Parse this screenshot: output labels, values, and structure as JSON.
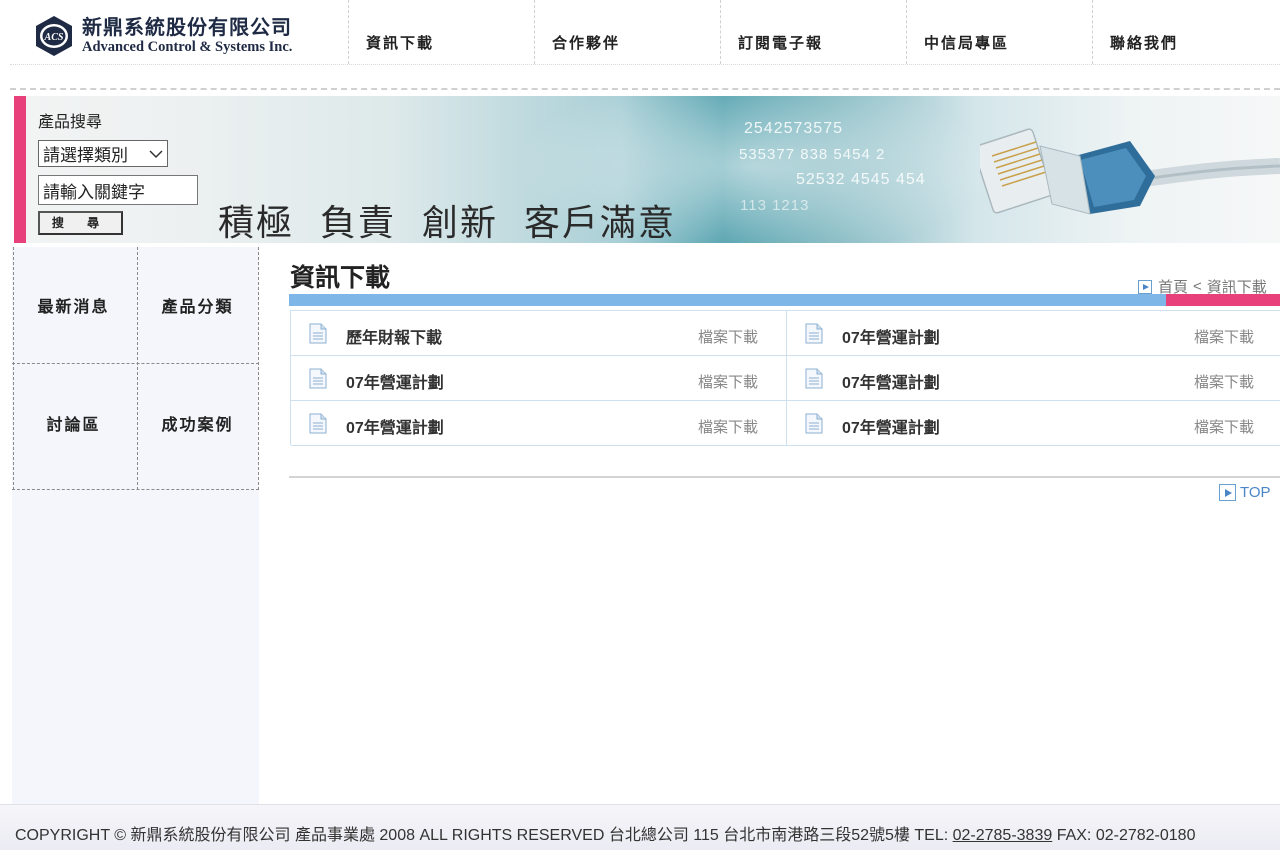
{
  "header": {
    "logo": {
      "mark": "ACS",
      "name_cn": "新鼎系統股份有限公司",
      "name_en": "Advanced Control & Systems Inc."
    },
    "nav": [
      {
        "label": "資訊下載"
      },
      {
        "label": "合作夥伴"
      },
      {
        "label": "訂閱電子報"
      },
      {
        "label": "中信局專區"
      },
      {
        "label": "聯絡我們"
      }
    ]
  },
  "banner": {
    "numbers": [
      "2542573575",
      "535377 838 5454 2",
      "52532 4545 454",
      "113 1213"
    ],
    "slogan": "積極 負責 創新 客戶滿意",
    "search": {
      "title": "產品搜尋",
      "select_value": "請選擇類別",
      "input_value": "請輸入關鍵字",
      "button_label": "搜 尋"
    }
  },
  "sidebar": {
    "items": [
      {
        "label": "最新消息"
      },
      {
        "label": "產品分類"
      },
      {
        "label": "討論區"
      },
      {
        "label": "成功案例"
      }
    ]
  },
  "main": {
    "title": "資訊下載",
    "breadcrumb": {
      "home": "首頁",
      "separator": "<",
      "current": "資訊下載"
    },
    "files": [
      {
        "name": "歷年財報下載",
        "action": "檔案下載"
      },
      {
        "name": "07年營運計劃",
        "action": "檔案下載"
      },
      {
        "name": "07年營運計劃",
        "action": "檔案下載"
      },
      {
        "name": "07年營運計劃",
        "action": "檔案下載"
      },
      {
        "name": "07年營運計劃",
        "action": "檔案下載"
      },
      {
        "name": "07年營運計劃",
        "action": "檔案下載"
      }
    ],
    "top_link": "TOP"
  },
  "footer": {
    "text_before": "COPYRIGHT © 新鼎系統股份有限公司 產品事業處 2008 ALL RIGHTS RESERVED 台北總公司 115 台北市南港路三段52號5樓 TEL: ",
    "tel": "02-2785-3839",
    "text_after": " FAX: 02-2782-0180"
  },
  "colors": {
    "accent_pink": "#e8407a",
    "accent_blue": "#7fb6e8",
    "sidebar_bg": "#f4f6fb"
  }
}
